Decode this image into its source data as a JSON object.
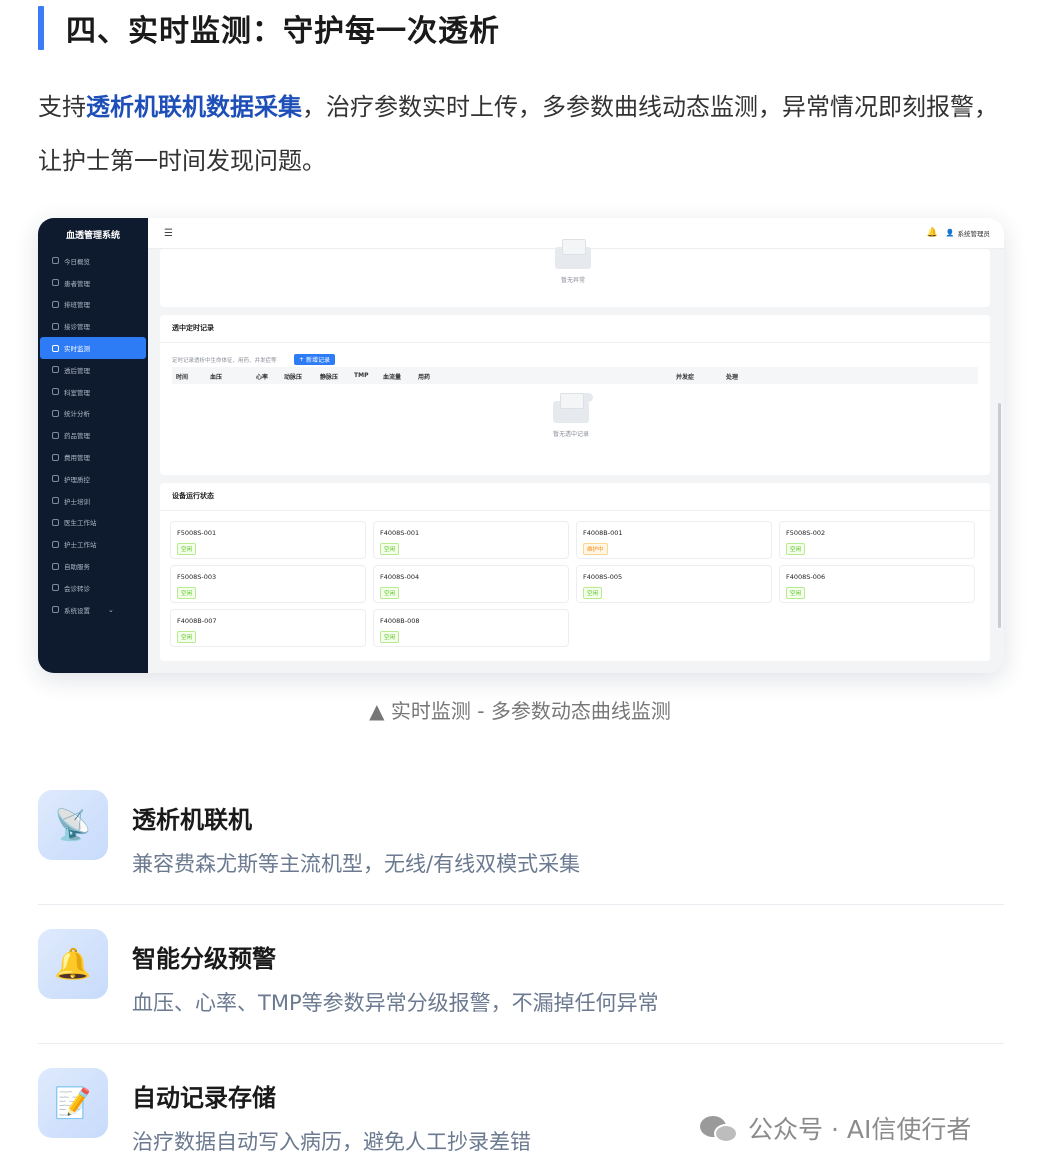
{
  "section": {
    "title": "四、实时监测：守护每一次透析"
  },
  "intro": {
    "before": "支持",
    "highlight": "透析机联机数据采集",
    "after": "，治疗参数实时上传，多参数曲线动态监测，异常情况即刻报警，让护士第一时间发现问题。"
  },
  "app": {
    "logo": "血透管理系统",
    "sidebar": [
      {
        "label": "今日概览",
        "icon": "clock-icon"
      },
      {
        "label": "患者管理",
        "icon": "user-icon"
      },
      {
        "label": "排班管理",
        "icon": "calendar-icon"
      },
      {
        "label": "接诊管理",
        "icon": "clipboard-icon"
      },
      {
        "label": "实时监测",
        "icon": "monitor-icon",
        "active": true
      },
      {
        "label": "透后管理",
        "icon": "document-icon"
      },
      {
        "label": "科室管理",
        "icon": "home-icon"
      },
      {
        "label": "统计分析",
        "icon": "chart-icon"
      },
      {
        "label": "药品管理",
        "icon": "pill-icon"
      },
      {
        "label": "费用管理",
        "icon": "money-icon"
      },
      {
        "label": "护理质控",
        "icon": "shield-icon"
      },
      {
        "label": "护士培训",
        "icon": "book-icon"
      },
      {
        "label": "医生工作站",
        "icon": "doctor-icon"
      },
      {
        "label": "护士工作站",
        "icon": "nurse-icon"
      },
      {
        "label": "自助服务",
        "icon": "screen-icon"
      },
      {
        "label": "会诊转诊",
        "icon": "transfer-icon"
      },
      {
        "label": "系统设置",
        "icon": "gear-icon"
      }
    ],
    "topbar": {
      "menu_icon": "☰",
      "bell_icon": "🔔",
      "user_icon": "👤",
      "user": "系统管理员"
    },
    "alerts_empty": "暂无异常",
    "timed_records": {
      "title": "透中定时记录",
      "hint": "定时记录透析中生命体征、用药、并发症等",
      "add_button": "新增记录",
      "columns": [
        "时间",
        "血压",
        "心率",
        "动脉压",
        "静脉压",
        "TMP",
        "血流量",
        "用药",
        "并发症",
        "处理"
      ],
      "empty": "暂无透中记录"
    },
    "devices": {
      "title": "设备运行状态",
      "items": [
        {
          "name": "F5008S-001",
          "status": "空闲"
        },
        {
          "name": "F4008S-001",
          "status": "空闲"
        },
        {
          "name": "F4008B-001",
          "status": "维护中",
          "warn": true
        },
        {
          "name": "F5008S-002",
          "status": "空闲"
        },
        {
          "name": "F5008S-003",
          "status": "空闲"
        },
        {
          "name": "F4008S-004",
          "status": "空闲"
        },
        {
          "name": "F4008S-005",
          "status": "空闲"
        },
        {
          "name": "F4008S-006",
          "status": "空闲"
        },
        {
          "name": "F4008B-007",
          "status": "空闲"
        },
        {
          "name": "F4008B-008",
          "status": "空闲"
        }
      ]
    }
  },
  "caption": "▲ 实时监测 - 多参数动态曲线监测",
  "features": [
    {
      "title": "透析机联机",
      "desc": "兼容费森尤斯等主流机型，无线/有线双模式采集",
      "icon": "📡"
    },
    {
      "title": "智能分级预警",
      "desc": "血压、心率、TMP等参数异常分级报警，不漏掉任何异常",
      "icon": "🔔"
    },
    {
      "title": "自动记录存储",
      "desc": "治疗数据自动写入病历，避免人工抄录差错",
      "icon": "📝"
    }
  ],
  "watermark": "公众号 · AI信使行者"
}
